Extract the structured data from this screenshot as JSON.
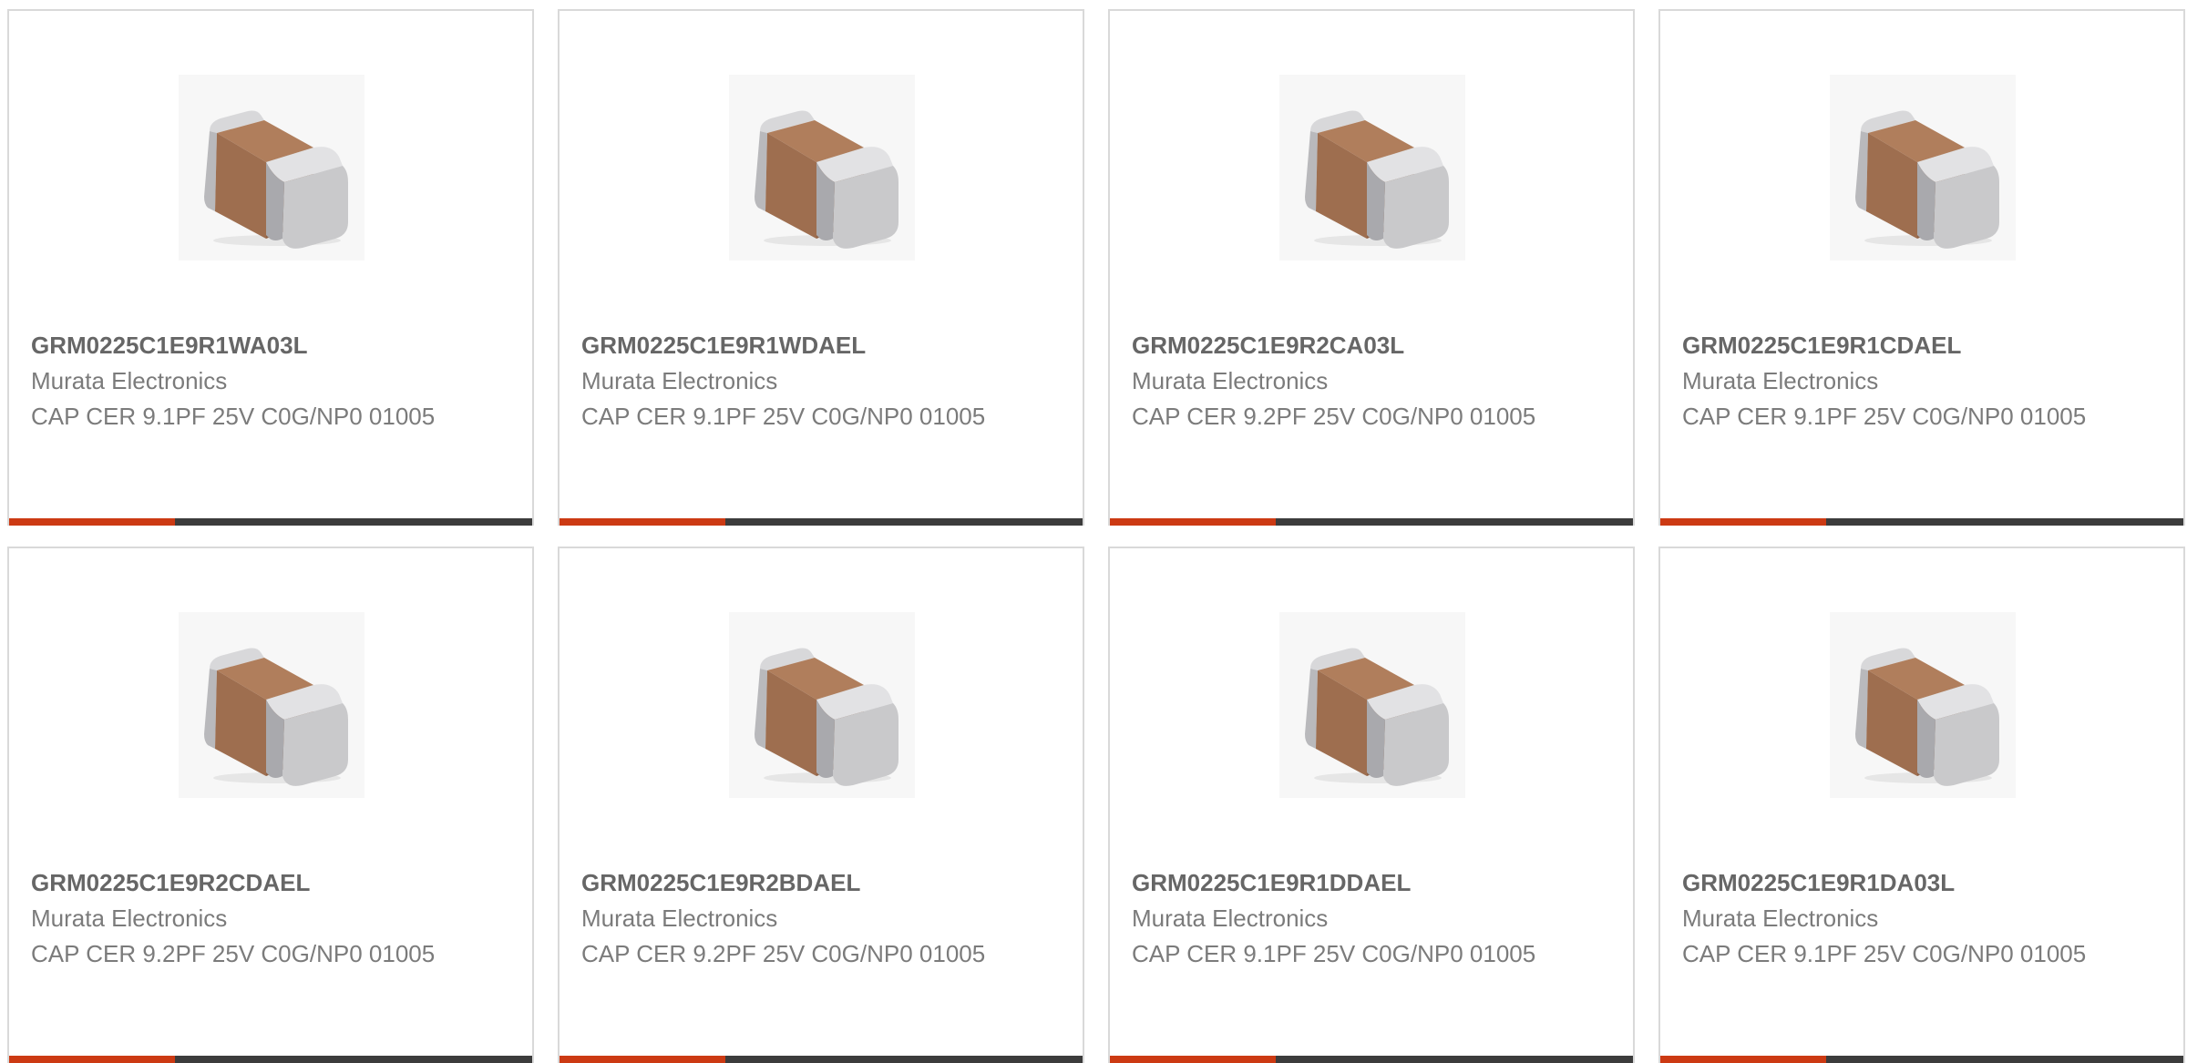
{
  "colors": {
    "accent": "#cc3a13",
    "bar": "#3c3c3c",
    "border": "#d9d9d9",
    "part_number_text": "#666666",
    "body_text": "#7b7b7b",
    "chip_body": "#9e6e4f",
    "chip_terminal": "#c9c9cb"
  },
  "image_icon": "ceramic-capacitor-chip-icon",
  "products": [
    {
      "part_number": "GRM0225C1E9R1WA03L",
      "manufacturer": "Murata Electronics",
      "description": "CAP CER 9.1PF 25V C0G/NP0 01005"
    },
    {
      "part_number": "GRM0225C1E9R1WDAEL",
      "manufacturer": "Murata Electronics",
      "description": "CAP CER 9.1PF 25V C0G/NP0 01005"
    },
    {
      "part_number": "GRM0225C1E9R2CA03L",
      "manufacturer": "Murata Electronics",
      "description": "CAP CER 9.2PF 25V C0G/NP0 01005"
    },
    {
      "part_number": "GRM0225C1E9R1CDAEL",
      "manufacturer": "Murata Electronics",
      "description": "CAP CER 9.1PF 25V C0G/NP0 01005"
    },
    {
      "part_number": "GRM0225C1E9R2CDAEL",
      "manufacturer": "Murata Electronics",
      "description": "CAP CER 9.2PF 25V C0G/NP0 01005"
    },
    {
      "part_number": "GRM0225C1E9R2BDAEL",
      "manufacturer": "Murata Electronics",
      "description": "CAP CER 9.2PF 25V C0G/NP0 01005"
    },
    {
      "part_number": "GRM0225C1E9R1DDAEL",
      "manufacturer": "Murata Electronics",
      "description": "CAP CER 9.1PF 25V C0G/NP0 01005"
    },
    {
      "part_number": "GRM0225C1E9R1DA03L",
      "manufacturer": "Murata Electronics",
      "description": "CAP CER 9.1PF 25V C0G/NP0 01005"
    }
  ]
}
